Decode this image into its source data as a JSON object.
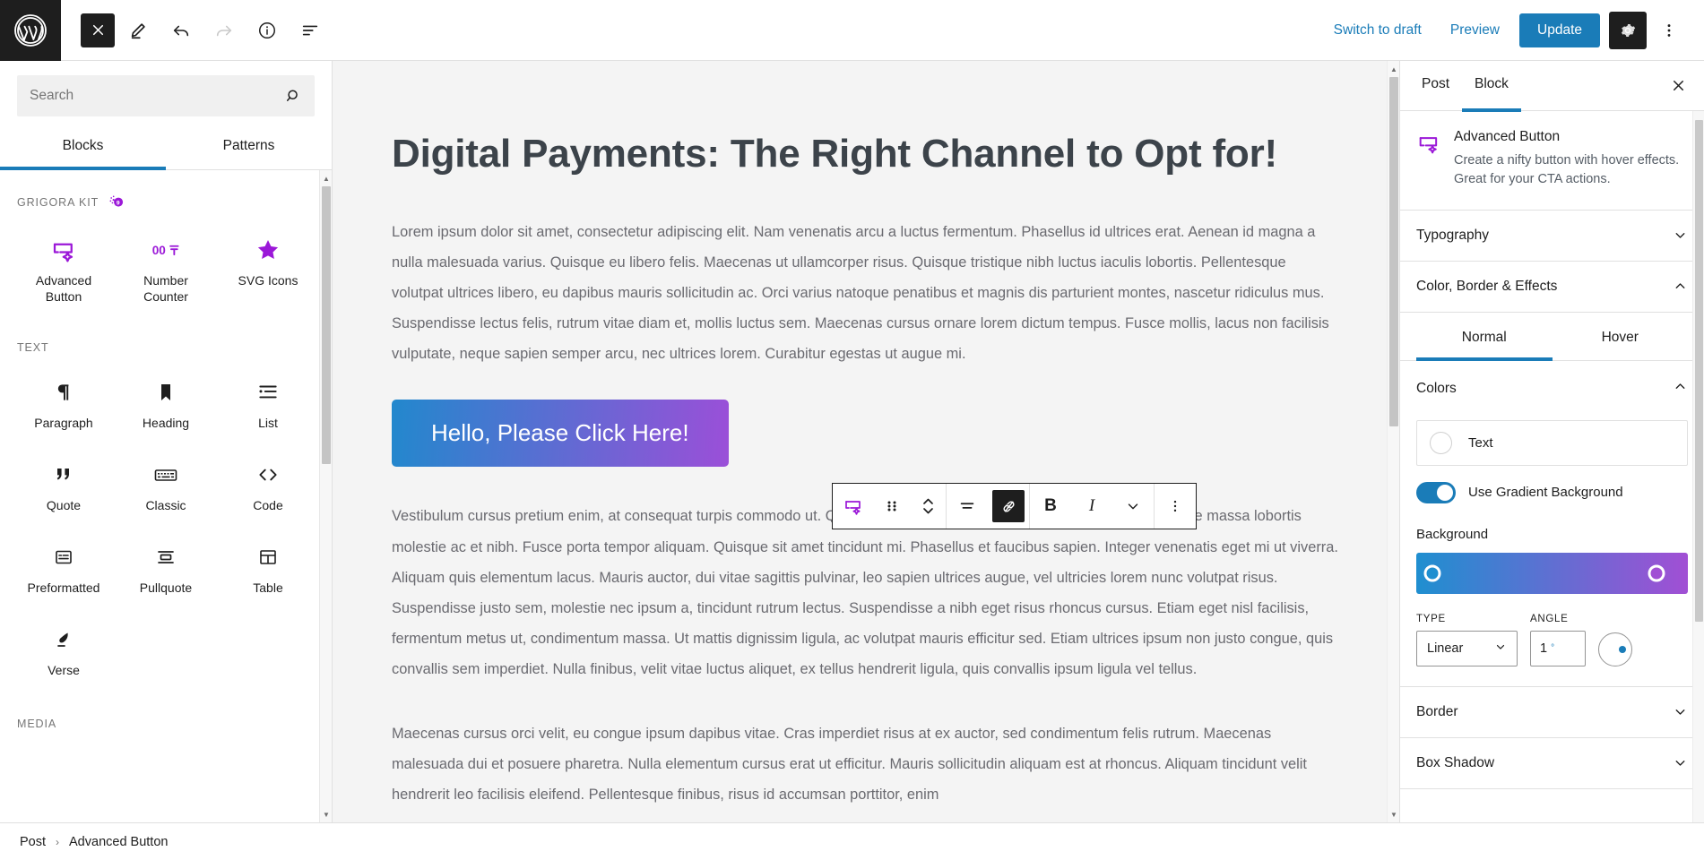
{
  "topbar": {
    "logo_icon": "wordpress-logo-icon",
    "close_icon": "close-icon",
    "edit_icon": "pencil-edit-icon",
    "undo_icon": "undo-arrow-icon",
    "redo_icon": "redo-arrow-icon",
    "info_icon": "info-circle-icon",
    "list_view_icon": "list-view-icon",
    "switch_to_draft": "Switch to draft",
    "preview": "Preview",
    "update": "Update",
    "settings_icon": "gear-icon",
    "options_icon": "kebab-menu-icon",
    "accent": "#1a7cb8"
  },
  "inserter": {
    "search_placeholder": "Search",
    "search_value": "",
    "search_icon": "search-icon",
    "tabs": [
      {
        "label": "Blocks",
        "active": true
      },
      {
        "label": "Patterns",
        "active": false
      }
    ],
    "categories": [
      {
        "label": "GRIGORA KIT",
        "badge_icon": "grigora-badge-icon",
        "blocks": [
          {
            "label": "Advanced Button",
            "icon": "advanced-button-icon",
            "purple": true
          },
          {
            "label": "Number Counter",
            "icon": "number-counter-icon",
            "purple": true
          },
          {
            "label": "SVG Icons",
            "icon": "star-icon",
            "purple": true
          }
        ]
      },
      {
        "label": "TEXT",
        "blocks": [
          {
            "label": "Paragraph",
            "icon": "paragraph-pilcrow-icon",
            "purple": false
          },
          {
            "label": "Heading",
            "icon": "heading-bookmark-icon",
            "purple": false
          },
          {
            "label": "List",
            "icon": "list-icon",
            "purple": false
          },
          {
            "label": "Quote",
            "icon": "quote-marks-icon",
            "purple": false
          },
          {
            "label": "Classic",
            "icon": "classic-keyboard-icon",
            "purple": false
          },
          {
            "label": "Code",
            "icon": "code-brackets-icon",
            "purple": false
          },
          {
            "label": "Preformatted",
            "icon": "preformatted-icon",
            "purple": false
          },
          {
            "label": "Pullquote",
            "icon": "pullquote-icon",
            "purple": false
          },
          {
            "label": "Table",
            "icon": "table-icon",
            "purple": false
          },
          {
            "label": "Verse",
            "icon": "verse-feather-icon",
            "purple": false
          }
        ]
      },
      {
        "label": "MEDIA",
        "blocks": []
      }
    ]
  },
  "canvas": {
    "title": "Digital Payments: The Right Channel to Opt for!",
    "paragraph1": "Lorem ipsum dolor sit amet, consectetur adipiscing elit. Nam venenatis arcu a luctus fermentum. Phasellus id ultrices erat. Aenean id magna a nulla malesuada varius. Quisque eu libero felis. Maecenas ut ullamcorper risus. Quisque tristique nibh luctus iaculis lobortis. Pellentesque volutpat ultrices libero, eu dapibus mauris sollicitudin ac. Orci varius natoque penatibus et magnis dis parturient montes, nascetur ridiculus mus. Suspendisse lectus felis, rutrum vitae diam et, mollis luctus sem. Maecenas cursus ornare lorem dictum tempus. Fusce mollis, lacus non facilisis vulputate, neque sapien semper arcu, nec ultrices lorem. Curabitur egestas ut augue mi.",
    "cta_label": "Hello, Please Click Here!",
    "cta_gradient_from": "#2288cd",
    "cta_gradient_to": "#9b4fd8",
    "paragraph2": "Vestibulum cursus pretium enim, at consequat turpis commodo ut. Quisque suscipit vestibulum pretium. Nulla eget eros vitae massa lobortis molestie ac et nibh. Fusce porta tempor aliquam. Quisque sit amet tincidunt mi. Phasellus et faucibus sapien. Integer venenatis eget mi ut viverra. Aliquam quis elementum lacus. Mauris auctor, dui vitae sagittis pulvinar, leo sapien ultrices augue, vel ultricies lorem nunc volutpat risus. Suspendisse justo sem, molestie nec ipsum a, tincidunt rutrum lectus. Suspendisse a nibh eget risus rhoncus cursus. Etiam eget nisl facilisis, fermentum metus ut, condimentum massa. Ut mattis dignissim ligula, ac volutpat mauris efficitur sed. Etiam ultrices ipsum non justo congue, quis convallis sem imperdiet. Nulla finibus, velit vitae luctus aliquet, ex tellus hendrerit ligula, quis convallis ipsum ligula vel tellus.",
    "paragraph3": "Maecenas cursus orci velit, eu congue ipsum dapibus vitae. Cras imperdiet risus at ex auctor, sed condimentum felis rutrum. Maecenas malesuada dui et posuere pharetra. Nulla elementum cursus erat ut efficitur. Mauris sollicitudin aliquam est at rhoncus. Aliquam tincidunt velit hendrerit leo facilisis eleifend. Pellentesque finibus, risus id accumsan porttitor, enim"
  },
  "block_toolbar": {
    "block_type_icon": "advanced-button-icon",
    "drag_icon": "drag-handle-icon",
    "move_icon": "move-up-down-icon",
    "align_icon": "align-icon",
    "link_icon": "link-icon",
    "bold_label": "B",
    "italic_label": "I",
    "more_formats_icon": "chevron-down-icon",
    "options_icon": "kebab-menu-icon"
  },
  "sidebar": {
    "tabs": [
      {
        "label": "Post",
        "active": false
      },
      {
        "label": "Block",
        "active": true
      }
    ],
    "close_icon": "close-icon",
    "block_card": {
      "icon": "advanced-button-icon",
      "title": "Advanced Button",
      "description": "Create a nifty button with hover effects. Great for your CTA actions."
    },
    "panels": [
      {
        "label": "Typography",
        "expanded": false,
        "chevron": "chevron-down-icon"
      },
      {
        "label": "Color, Border & Effects",
        "expanded": true,
        "chevron": "chevron-up-icon"
      }
    ],
    "state_tabs": [
      {
        "label": "Normal",
        "active": true
      },
      {
        "label": "Hover",
        "active": false
      }
    ],
    "colors": {
      "heading": "Colors",
      "chevron": "chevron-up-icon",
      "text_swatch_label": "Text",
      "gradient_toggle_label": "Use Gradient Background",
      "gradient_toggle_on": true,
      "background_label": "Background",
      "gradient_from": "#1f8fd0",
      "gradient_to": "#a14fd4",
      "type_caption": "TYPE",
      "type_value": "Linear",
      "angle_caption": "ANGLE",
      "angle_value": "1",
      "angle_unit": "°"
    },
    "bottom_panels": [
      {
        "label": "Border",
        "chevron": "chevron-down-icon"
      },
      {
        "label": "Box Shadow",
        "chevron": "chevron-down-icon"
      }
    ]
  },
  "footer": {
    "crumbs": [
      "Post",
      "Advanced Button"
    ],
    "separator": "›"
  }
}
